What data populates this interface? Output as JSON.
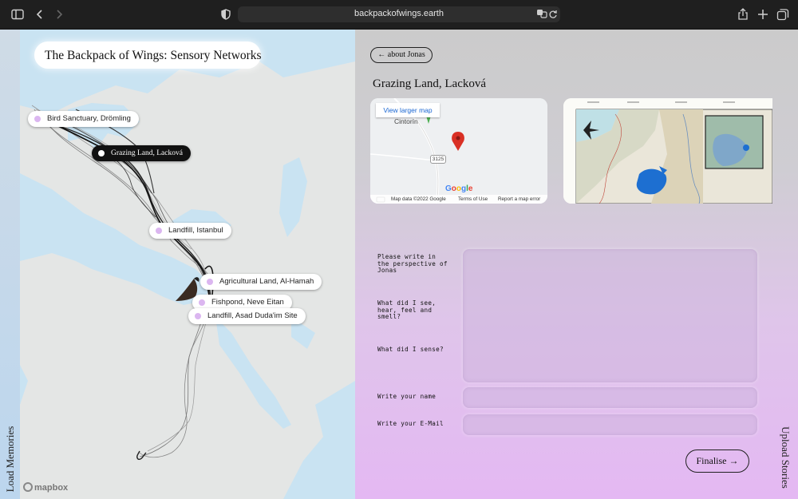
{
  "browser": {
    "url": "backpackofwings.earth",
    "icons": [
      "sidebar-icon",
      "back-arrow-icon",
      "forward-arrow-icon",
      "shield-icon",
      "translate-icon",
      "reload-icon",
      "share-icon",
      "new-tab-plus-icon",
      "tabs-overview-icon"
    ]
  },
  "left_strip": {
    "label": "Load Memories"
  },
  "map": {
    "title": "The Backpack of Wings:  Sensory Networks",
    "attribution": "mapbox",
    "pins": [
      {
        "label": "Bird Sanctuary, Drömling",
        "active": false
      },
      {
        "label": "Grazing Land, Lacková",
        "active": true
      },
      {
        "label": "Landfill, Istanbul",
        "active": false
      },
      {
        "label": "Agricultural Land, Al-Hamah",
        "active": false
      },
      {
        "label": "Fishpond, Neve Eitan",
        "active": false
      },
      {
        "label": "Landfill, Asad Duda'im Site",
        "active": false
      }
    ]
  },
  "panel": {
    "back_button": "← about Jonas",
    "place_title": "Grazing Land, Lacková",
    "google_map": {
      "larger_link": "View larger map",
      "town": "Cintorín",
      "road_number": "3125",
      "logo": "Google",
      "footer": [
        "Map data ©2022 Google",
        "Terms of Use",
        "Report a map error"
      ]
    },
    "form": {
      "prompt_1": "Please write in\nthe perspective of\nJonas",
      "prompt_2": "What did I see,\nhear, feel and\nsmell?",
      "prompt_3": "What did I sense?",
      "name_label": "Write your name",
      "email_label": "Write your E-Mail",
      "story_value": "",
      "name_value": "",
      "email_value": ""
    },
    "finalise_button": "Finalise →",
    "right_label": "Upload Stories"
  }
}
